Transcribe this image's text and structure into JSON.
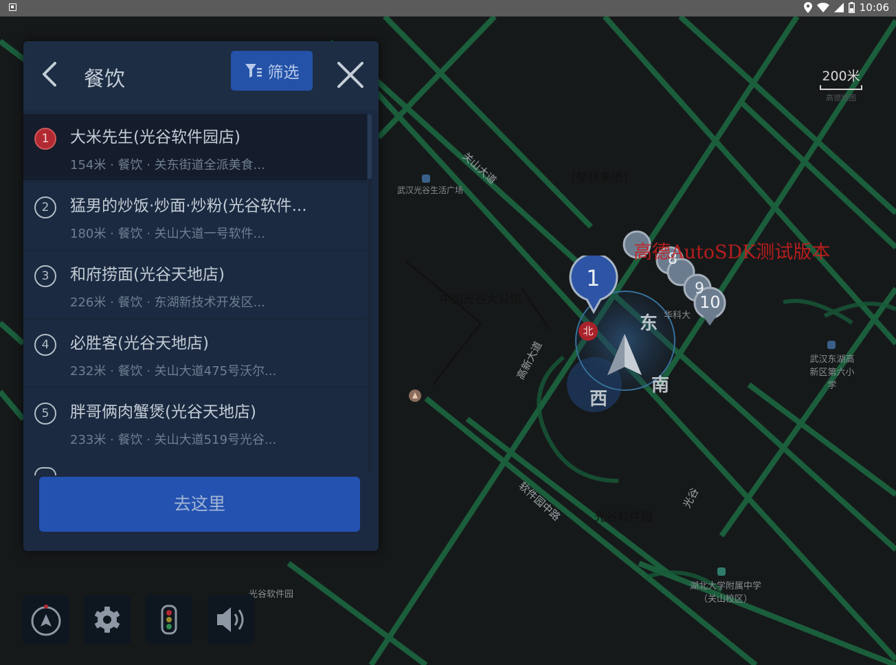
{
  "status_bar": {
    "time": "10:06",
    "icons": [
      "location-icon",
      "wifi-icon",
      "cell-signal-icon",
      "battery-icon"
    ]
  },
  "map": {
    "scale_label": "200米",
    "scale_sub": "高德地图",
    "watermark": "高德AutoSDK测试版本",
    "labels": {
      "road_guanshan": "关山大道",
      "road_gaoxin": "高新大道",
      "road_software": "软件园中路",
      "road_guangu": "光谷",
      "building_top": "[郁林美地]",
      "building_mid": "中国光谷大公馆",
      "building_bottom": "光谷软件园",
      "poi_left": "武汉光谷生活广场",
      "school_right": "武汉东湖高新区第六小学",
      "school_bottom": "湖北大学附属中学（关山校区）",
      "poi_bottom_left": "光谷软件园",
      "poi_huake": "华科大"
    },
    "cluster_numbers": [
      "1",
      "8",
      "9",
      "10"
    ],
    "compass": {
      "north": "北",
      "east": "东",
      "south": "南",
      "west": "西"
    }
  },
  "panel": {
    "title": "餐饮",
    "filter_label": "筛选",
    "go_label": "去这里",
    "results": [
      {
        "index": "1",
        "name": "大米先生(光谷软件园店)",
        "detail": "154米 · 餐饮 · 关东街道全派美食..."
      },
      {
        "index": "2",
        "name": "猛男的炒饭·炒面·炒粉(光谷软件...",
        "detail": "180米 · 餐饮 · 关山大道一号软件..."
      },
      {
        "index": "3",
        "name": "和府捞面(光谷天地店)",
        "detail": "226米 · 餐饮 · 东湖新技术开发区..."
      },
      {
        "index": "4",
        "name": "必胜客(光谷天地店)",
        "detail": "232米 · 餐饮 · 关山大道475号沃尔..."
      },
      {
        "index": "5",
        "name": "胖哥俩肉蟹煲(光谷天地店)",
        "detail": "233米 · 餐饮 · 关山大道519号光谷..."
      }
    ]
  },
  "controls": [
    "compass-mode-icon",
    "settings-icon",
    "traffic-light-icon",
    "volume-icon"
  ],
  "colors": {
    "panel_bg": "#1b2a41",
    "button_blue": "#2352b0",
    "selected_marker": "#b32931",
    "road_green": "#1f7a4b"
  }
}
